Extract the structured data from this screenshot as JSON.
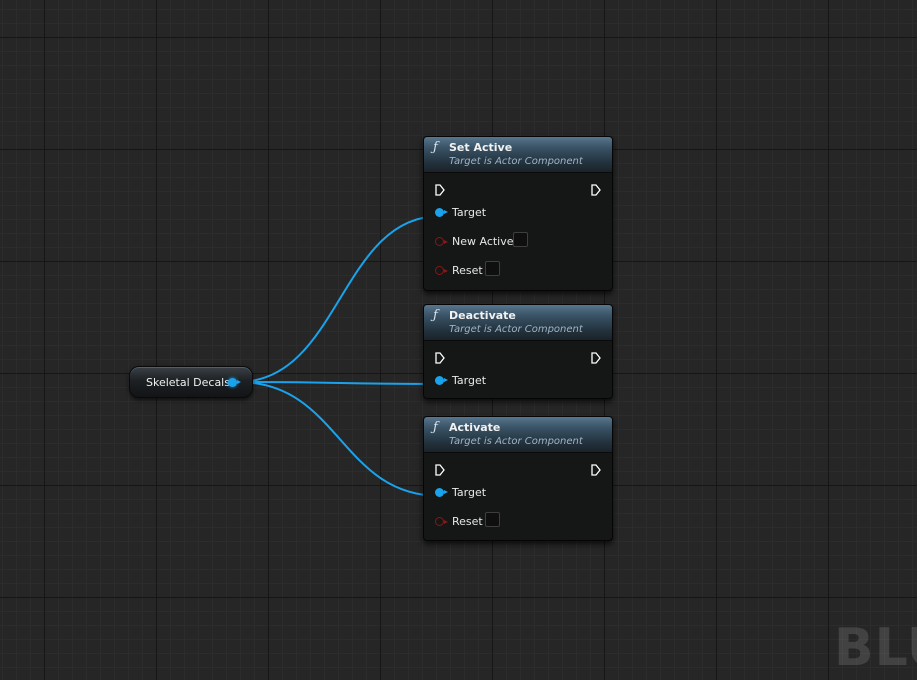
{
  "colors": {
    "object_pin": "#1aa3ec",
    "bool_pin": "#8a1717",
    "exec_pin": "#ffffff",
    "header_blue": "#3a5366"
  },
  "watermark": "BLU",
  "variable_node": {
    "label": "Skeletal Decals",
    "pin_type": "object"
  },
  "function_nodes": [
    {
      "icon": "function-icon",
      "title": "Set Active",
      "subtitle": "Target is Actor Component",
      "inputs": [
        {
          "label": "Target",
          "type": "object",
          "connected": true
        },
        {
          "label": "New Active",
          "type": "bool",
          "value": false
        },
        {
          "label": "Reset",
          "type": "bool",
          "value": false
        }
      ]
    },
    {
      "icon": "function-icon",
      "title": "Deactivate",
      "subtitle": "Target is Actor Component",
      "inputs": [
        {
          "label": "Target",
          "type": "object",
          "connected": true
        }
      ]
    },
    {
      "icon": "function-icon",
      "title": "Activate",
      "subtitle": "Target is Actor Component",
      "inputs": [
        {
          "label": "Target",
          "type": "object",
          "connected": true
        },
        {
          "label": "Reset",
          "type": "bool",
          "value": false
        }
      ]
    }
  ]
}
